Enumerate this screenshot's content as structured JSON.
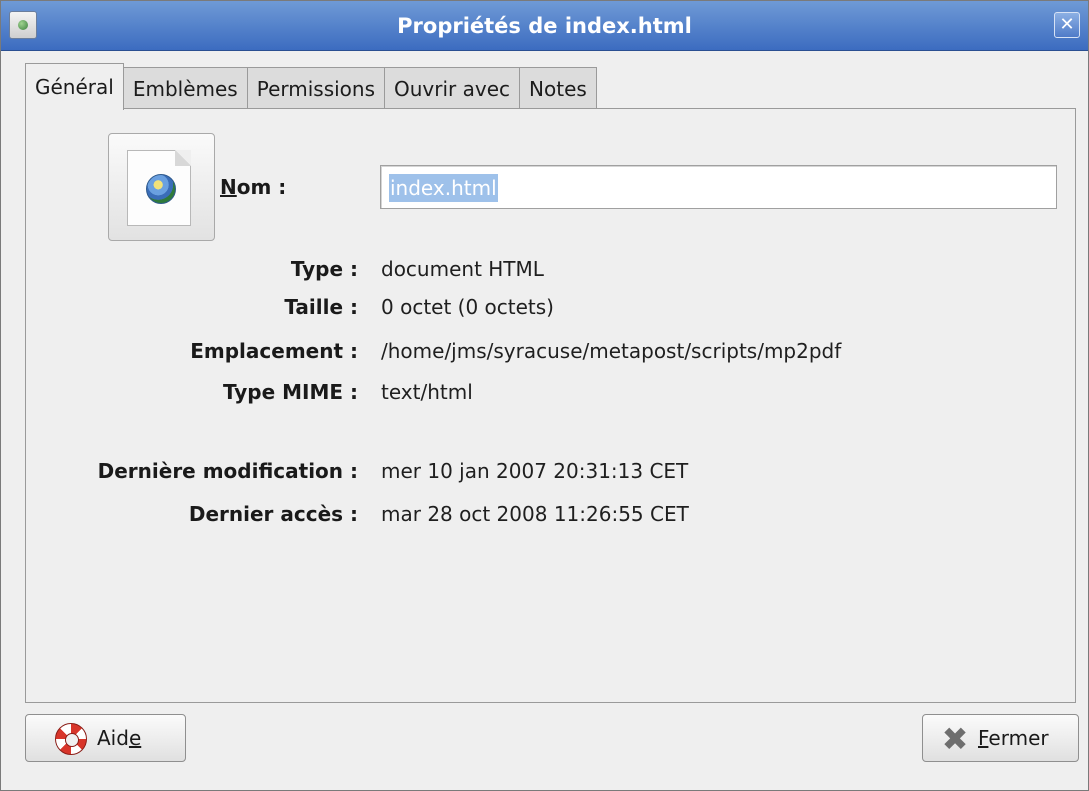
{
  "window": {
    "title": "Propriétés de index.html",
    "close_glyph": "✕"
  },
  "tabs": [
    {
      "label": "Général",
      "active": true
    },
    {
      "label": "Emblèmes",
      "active": false
    },
    {
      "label": "Permissions",
      "active": false
    },
    {
      "label": "Ouvrir avec",
      "active": false
    },
    {
      "label": "Notes",
      "active": false
    }
  ],
  "general": {
    "name_label_mnemonic": "N",
    "name_label_rest": "om :",
    "name_value": "index.html",
    "type_label": "Type :",
    "type_value": "document HTML",
    "size_label": "Taille :",
    "size_value": "0 octet (0 octets)",
    "location_label": "Emplacement :",
    "location_value": "/home/jms/syracuse/metapost/scripts/mp2pdf",
    "mime_label": "Type MIME :",
    "mime_value": "text/html",
    "modified_label": "Dernière modification :",
    "modified_value": "mer 10 jan 2007 20:31:13 CET",
    "accessed_label": "Dernier accès :",
    "accessed_value": "mar 28 oct 2008 11:26:55 CET"
  },
  "buttons": {
    "help_before": "Aid",
    "help_mnemonic": "e",
    "close_mnemonic": "F",
    "close_rest": "ermer"
  },
  "icons": {
    "file": "html-document-globe-icon",
    "help": "lifebuoy-icon",
    "close": "x-icon"
  }
}
